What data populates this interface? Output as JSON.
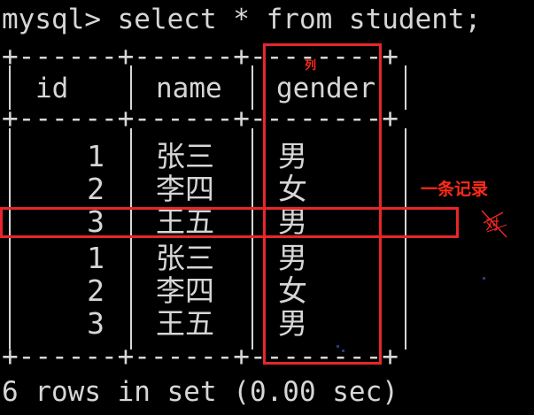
{
  "terminal": {
    "command_line": "mysql> select * from student;",
    "border_line": "+------+------+--------+",
    "footer": "6 rows in set (0.00 sec)"
  },
  "table": {
    "columns": [
      "id",
      "name",
      "gender"
    ],
    "rows": [
      {
        "id": "1",
        "name": "张三",
        "gender": "男"
      },
      {
        "id": "2",
        "name": "李四",
        "gender": "女"
      },
      {
        "id": "3",
        "name": "王五",
        "gender": "男"
      },
      {
        "id": "1",
        "name": "张三",
        "gender": "男"
      },
      {
        "id": "2",
        "name": "李四",
        "gender": "女"
      },
      {
        "id": "3",
        "name": "王五",
        "gender": "男"
      }
    ]
  },
  "annotations": {
    "column_label": "列",
    "record_label": "一条记录",
    "side_mark": "对"
  },
  "colors": {
    "background": "#000000",
    "terminal_text": "#d6d6d6",
    "annotation_red": "#e8262a"
  }
}
